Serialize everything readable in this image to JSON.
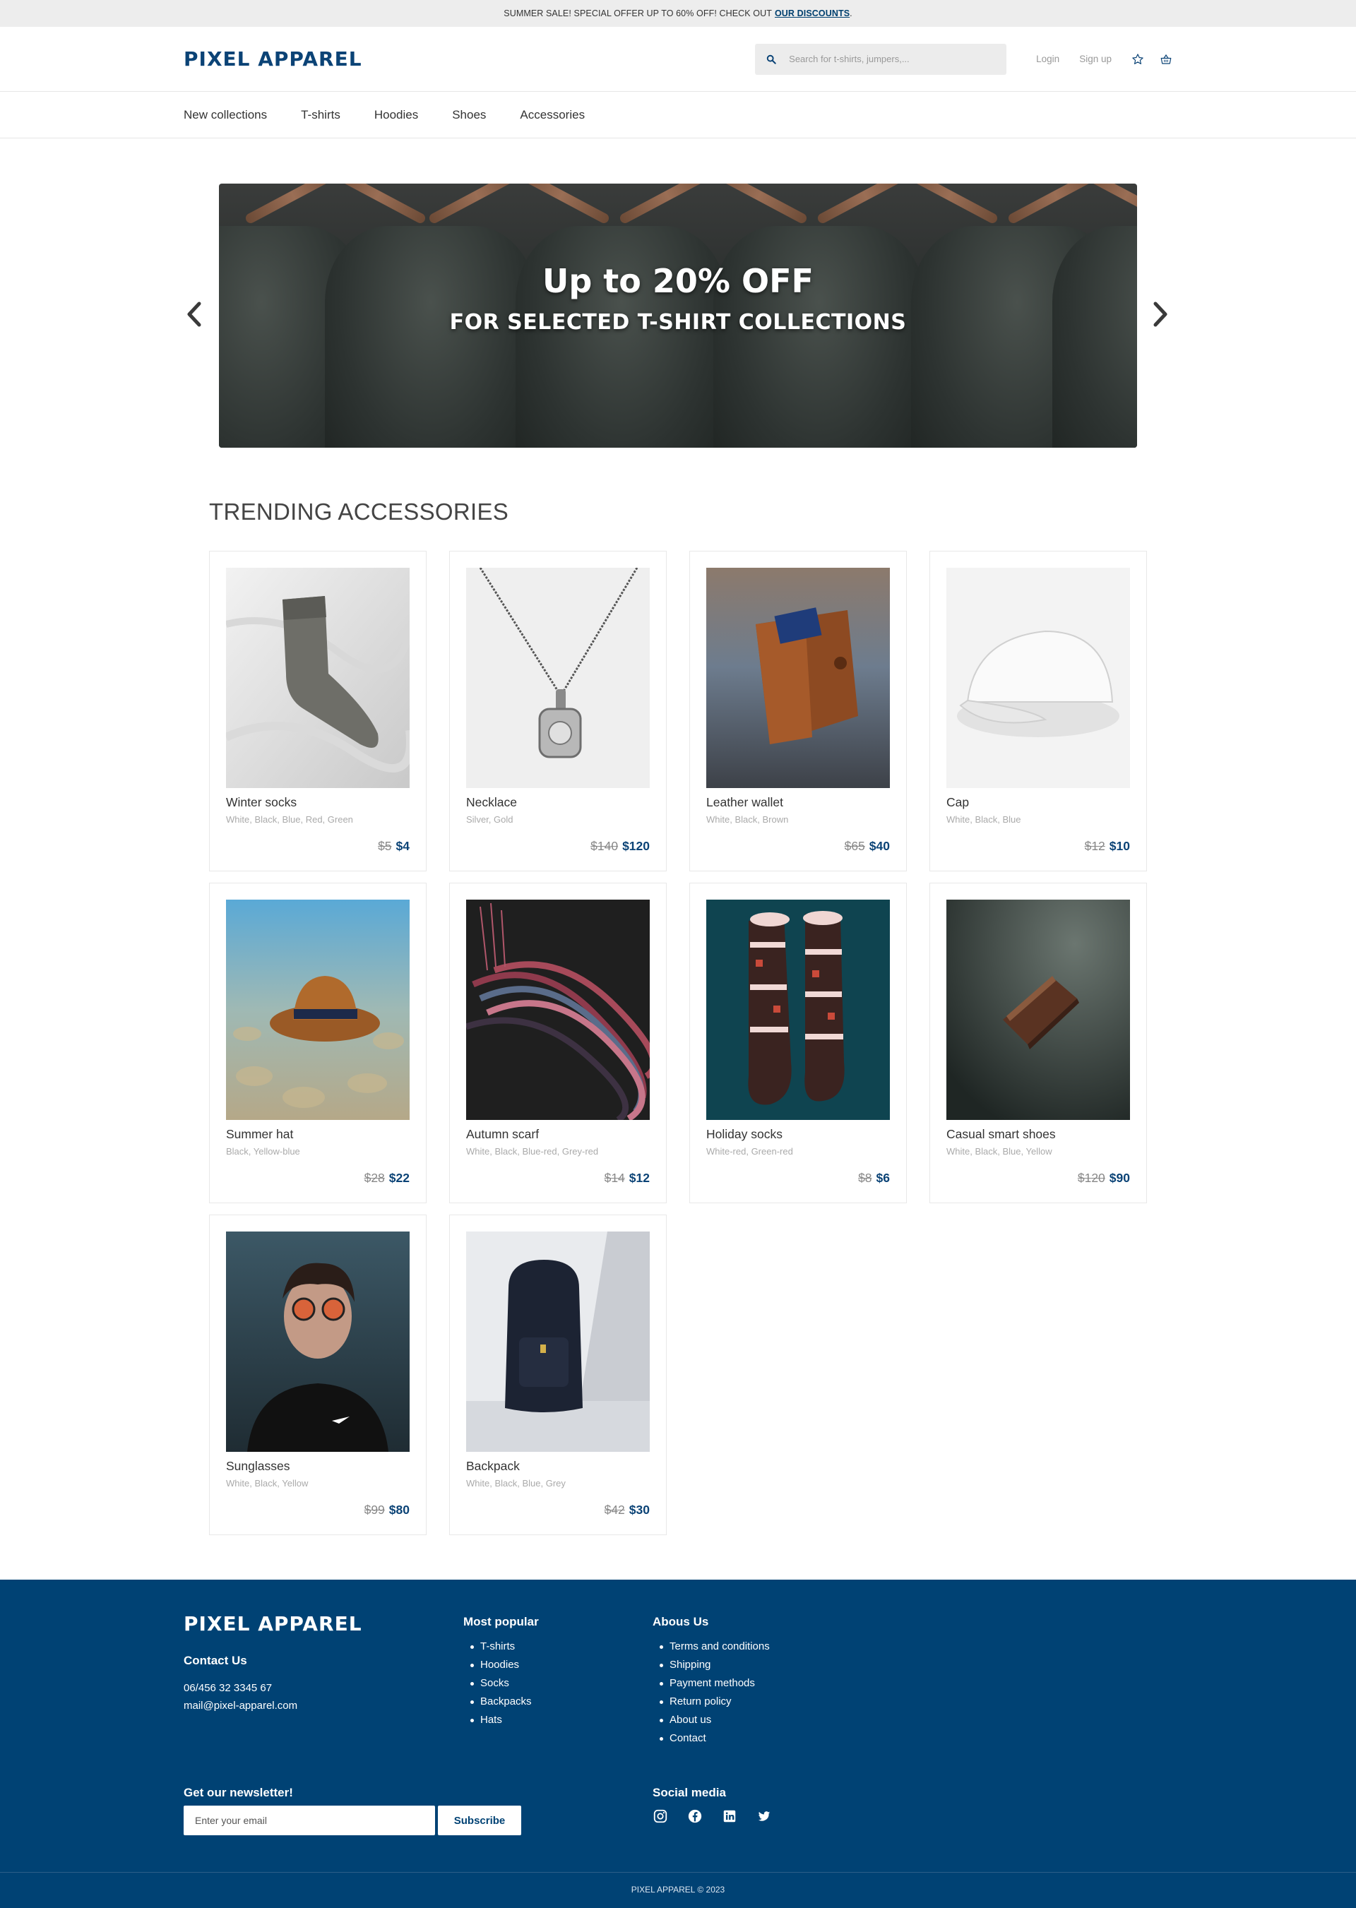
{
  "topbar": {
    "text": "SUMMER SALE! SPECIAL OFFER UP TO 60% OFF! CHECK OUT",
    "link": "OUR DISCOUNTS",
    "tail": "."
  },
  "header": {
    "logo": "PIXEL APPAREL",
    "search_placeholder": "Search for t-shirts, jumpers,...",
    "login": "Login",
    "signup": "Sign up",
    "icons": [
      "search-icon",
      "star-icon",
      "basket-icon"
    ]
  },
  "nav": {
    "items": [
      "New collections",
      "T-shirts",
      "Hoodies",
      "Shoes",
      "Accessories"
    ]
  },
  "hero": {
    "title": "Up to 20% OFF",
    "subtitle": "FOR SELECTED T-SHIRT COLLECTIONS"
  },
  "section": {
    "title": "TRENDING ACCESSORIES"
  },
  "products": [
    {
      "name": "Winter socks",
      "colors": "White, Black, Blue, Red, Green",
      "old_price": "$5",
      "price": "$4"
    },
    {
      "name": "Necklace",
      "colors": "Silver, Gold",
      "old_price": "$140",
      "price": "$120"
    },
    {
      "name": "Leather wallet",
      "colors": "White, Black, Brown",
      "old_price": "$65",
      "price": "$40"
    },
    {
      "name": "Cap",
      "colors": "White, Black, Blue",
      "old_price": "$12",
      "price": "$10"
    },
    {
      "name": "Summer hat",
      "colors": "Black, Yellow-blue",
      "old_price": "$28",
      "price": "$22"
    },
    {
      "name": "Autumn scarf",
      "colors": "White, Black, Blue-red, Grey-red",
      "old_price": "$14",
      "price": "$12"
    },
    {
      "name": "Holiday socks",
      "colors": "White-red, Green-red",
      "old_price": "$8",
      "price": "$6"
    },
    {
      "name": "Casual smart shoes",
      "colors": "White, Black, Blue, Yellow",
      "old_price": "$120",
      "price": "$90"
    },
    {
      "name": "Sunglasses",
      "colors": "White, Black, Yellow",
      "old_price": "$99",
      "price": "$80"
    },
    {
      "name": "Backpack",
      "colors": "White, Black, Blue, Grey",
      "old_price": "$42",
      "price": "$30"
    }
  ],
  "footer": {
    "logo": "PIXEL APPAREL",
    "contact_title": "Contact Us",
    "phone": "06/456 32 3345 67",
    "email": "mail@pixel-apparel.com",
    "popular_title": "Most popular",
    "popular": [
      "T-shirts",
      "Hoodies",
      "Socks",
      "Backpacks",
      "Hats"
    ],
    "about_title": "Abous Us",
    "about": [
      "Terms and conditions",
      "Shipping",
      "Payment methods",
      "Return policy",
      "About us",
      "Contact"
    ],
    "newsletter_title": "Get our newsletter!",
    "newsletter_placeholder": "Enter your email",
    "subscribe": "Subscribe",
    "social_title": "Social media",
    "social_icons": [
      "instagram-icon",
      "facebook-icon",
      "linkedin-icon",
      "twitter-icon"
    ],
    "copyright": "PIXEL APPAREL © 2023"
  },
  "colors": {
    "brand": "#0b4376",
    "footer_bg": "#004274",
    "topbar_bg": "#ededed"
  }
}
